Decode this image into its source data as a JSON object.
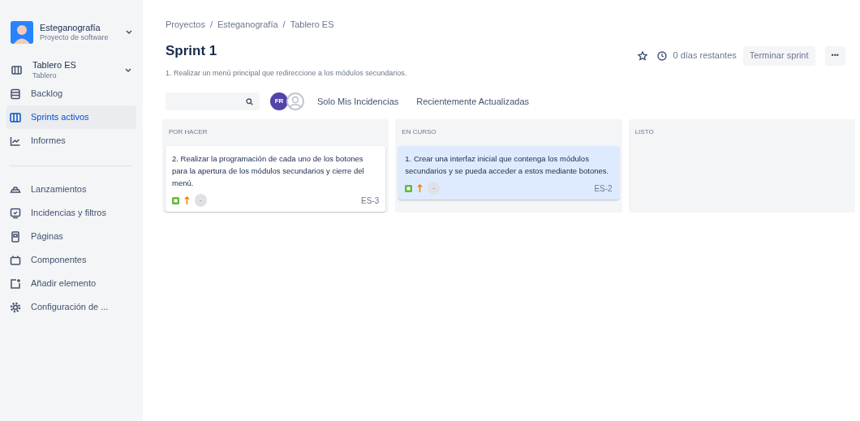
{
  "project": {
    "name": "Esteganografía",
    "type": "Proyecto de software"
  },
  "board_switcher": {
    "name": "Tablero ES",
    "type": "Tablero"
  },
  "sidebar": {
    "items": [
      {
        "label": "Backlog",
        "selected": false
      },
      {
        "label": "Sprints activos",
        "selected": true
      },
      {
        "label": "Informes",
        "selected": false
      }
    ],
    "items_2": [
      {
        "label": "Lanzamientos"
      },
      {
        "label": "Incidencias y filtros"
      },
      {
        "label": "Páginas"
      },
      {
        "label": "Componentes"
      },
      {
        "label": "Añadir elemento"
      },
      {
        "label": "Configuración de ..."
      }
    ]
  },
  "breadcrumbs": [
    "Proyectos",
    "Esteganografía",
    "Tablero ES"
  ],
  "breadcrumb_separator": "/",
  "title": "Sprint 1",
  "sprint_goal": "1. Realizar un menú principal que redireccione a los módulos secundarios.",
  "header_actions": {
    "remaining": "0 días restantes",
    "complete_button": "Terminar sprint",
    "more": "•••"
  },
  "filters": {
    "avatar_initials": "FR",
    "quick_filters": [
      "Solo Mis Incidencias",
      "Recientemente Actualizadas"
    ]
  },
  "columns": [
    {
      "title": "POR HACER",
      "cards": [
        {
          "summary": "2. Realizar la programación de cada uno de los botones para la apertura de los módulos secundarios y cierre del menú.",
          "estimate": "-",
          "key": "ES-3",
          "selected": false
        }
      ]
    },
    {
      "title": "EN CURSO",
      "cards": [
        {
          "summary": "1. Crear una interfaz inicial que contenga los módulos secundarios y se pueda acceder a estos mediante botones.",
          "estimate": "-",
          "key": "ES-2",
          "selected": true
        }
      ]
    },
    {
      "title": "LISTO"
    }
  ]
}
